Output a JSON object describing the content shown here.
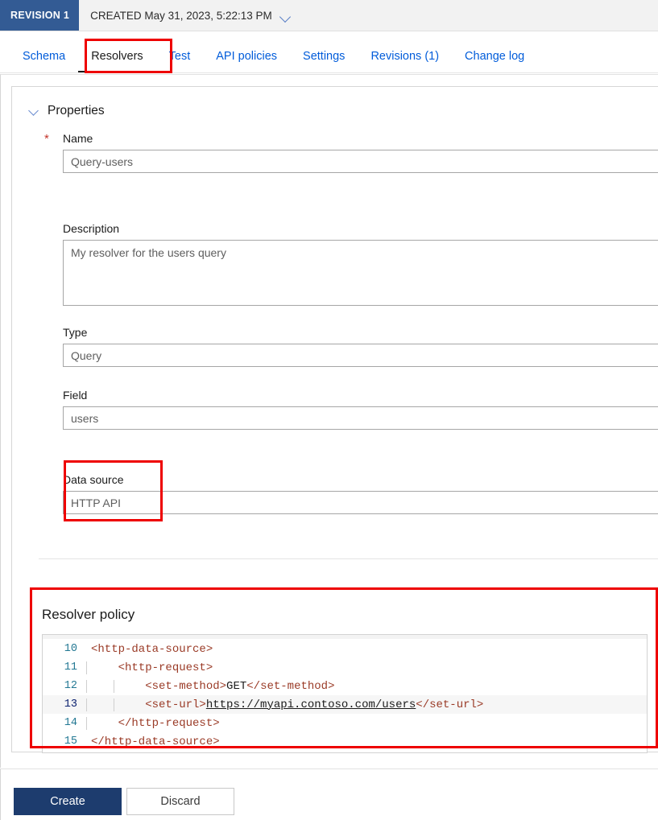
{
  "revision": {
    "badge": "REVISION 1",
    "created_text": "CREATED May 31, 2023, 5:22:13 PM",
    "chevron_icon": "chevron-down-icon",
    "badge_color": "#335b94"
  },
  "tabs": [
    {
      "label": "Schema",
      "active": false
    },
    {
      "label": "Resolvers",
      "active": true
    },
    {
      "label": "Test",
      "active": false
    },
    {
      "label": "API policies",
      "active": false
    },
    {
      "label": "Settings",
      "active": false
    },
    {
      "label": "Revisions (1)",
      "active": false
    },
    {
      "label": "Change log",
      "active": false
    }
  ],
  "properties": {
    "section_title": "Properties",
    "collapse_icon": "chevron-down-icon",
    "name": {
      "label": "Name",
      "required_marker": "*",
      "value": "Query-users"
    },
    "description": {
      "label": "Description",
      "value": "My resolver for the users query"
    },
    "type": {
      "label": "Type",
      "value": "Query"
    },
    "field": {
      "label": "Field",
      "value": "users"
    },
    "data_source": {
      "label": "Data source",
      "value": "HTTP API"
    }
  },
  "resolver_policy": {
    "title": "Resolver policy",
    "lines": [
      {
        "num": "10",
        "indent": 0,
        "text": "<http-data-source>",
        "current": false,
        "guides": 0
      },
      {
        "num": "11",
        "indent": 1,
        "text": "<http-request>",
        "current": false,
        "guides": 1
      },
      {
        "num": "12",
        "indent": 2,
        "text": "<set-method>GET</set-method>",
        "current": false,
        "guides": 2
      },
      {
        "num": "13",
        "indent": 2,
        "text": "<set-url>https://myapi.contoso.com/users</set-url>",
        "current": true,
        "guides": 2,
        "url": "https://myapi.contoso.com/users"
      },
      {
        "num": "14",
        "indent": 1,
        "text": "</http-request>",
        "current": false,
        "guides": 1
      },
      {
        "num": "15",
        "indent": 0,
        "text": "</http-data-source>",
        "current": false,
        "guides": 0
      }
    ]
  },
  "footer": {
    "create_label": "Create",
    "discard_label": "Discard"
  },
  "annotations": {
    "highlight_color": "#ee0000",
    "boxes": [
      "resolvers-tab",
      "data-source-field",
      "resolver-policy-section"
    ]
  }
}
